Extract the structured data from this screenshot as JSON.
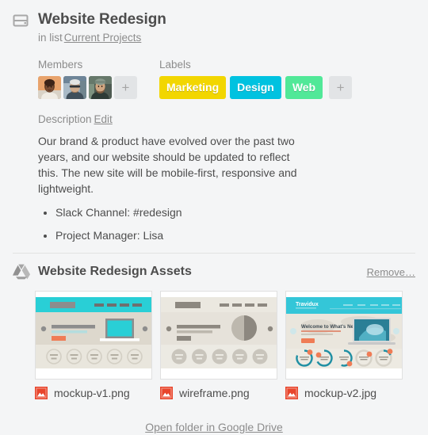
{
  "card": {
    "icon": "card-window-icon",
    "title": "Website Redesign",
    "in_list_prefix": "in list",
    "list_name": "Current Projects"
  },
  "members": {
    "heading": "Members",
    "avatars": [
      {
        "name": "member-avatar-1",
        "alt": "member photo 1"
      },
      {
        "name": "member-avatar-2",
        "alt": "member photo 2"
      },
      {
        "name": "member-avatar-3",
        "alt": "member photo 3"
      }
    ],
    "add_label": "+"
  },
  "labels": {
    "heading": "Labels",
    "items": [
      {
        "text": "Marketing",
        "color": "#f2d600"
      },
      {
        "text": "Design",
        "color": "#00c2e0"
      },
      {
        "text": "Web",
        "color": "#51e898"
      }
    ],
    "add_label": "+"
  },
  "description": {
    "heading": "Description",
    "edit_label": "Edit",
    "paragraph": "Our brand & product have evolved over the past two years, and our website should be updated to reflect this. The new site will be mobile-first, responsive and lightweight.",
    "bullets": [
      "Slack Channel: #redesign",
      "Project Manager: Lisa"
    ]
  },
  "attachment": {
    "icon": "google-drive-icon",
    "title": "Website Redesign Assets",
    "remove_label": "Remove…",
    "files": [
      {
        "name": "mockup-v1.png",
        "icon": "image-file-icon",
        "preview": "mockup-v1"
      },
      {
        "name": "wireframe.png",
        "icon": "image-file-icon",
        "preview": "wireframe"
      },
      {
        "name": "mockup-v2.jpg",
        "icon": "image-file-icon",
        "preview": "mockup-v2"
      }
    ],
    "open_folder_label": "Open folder in Google Drive",
    "preview_brand_text": "Travidux",
    "preview_hero_text": "Welcome to What's Next"
  },
  "colors": {
    "background": "#f4f5f6",
    "text": "#4d4d4d",
    "muted": "#8c8c8c",
    "accent_cyan": "#29cfd6",
    "accent_orange": "#ef7c56",
    "file_icon_red": "#e8452c"
  }
}
